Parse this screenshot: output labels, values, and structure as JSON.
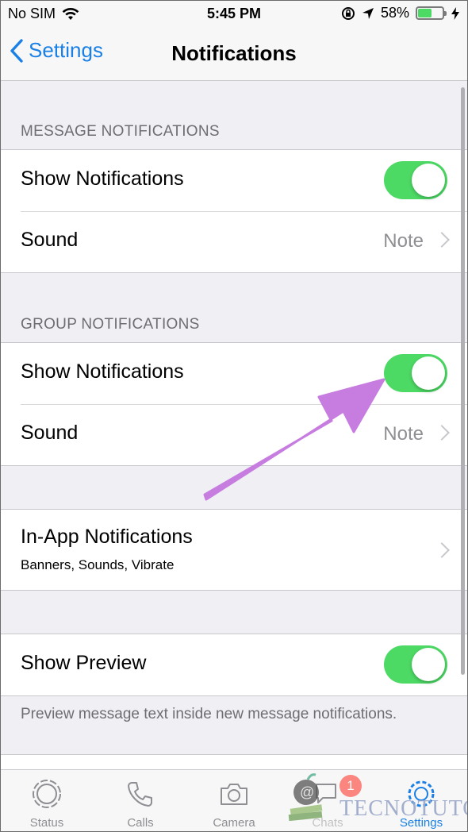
{
  "status_bar": {
    "carrier": "No SIM",
    "time": "5:45 PM",
    "battery_percent": "58%",
    "battery_level": 0.58,
    "icons": [
      "wifi-icon",
      "orientation-lock-icon",
      "location-icon",
      "battery-icon",
      "charging-icon"
    ]
  },
  "nav": {
    "back_label": "Settings",
    "title": "Notifications"
  },
  "message_notifications": {
    "header": "MESSAGE NOTIFICATIONS",
    "show_label": "Show Notifications",
    "show_enabled": true,
    "sound_label": "Sound",
    "sound_value": "Note"
  },
  "group_notifications": {
    "header": "GROUP NOTIFICATIONS",
    "show_label": "Show Notifications",
    "show_enabled": true,
    "sound_label": "Sound",
    "sound_value": "Note"
  },
  "in_app": {
    "label": "In-App Notifications",
    "subtitle": "Banners, Sounds, Vibrate"
  },
  "preview": {
    "label": "Show Preview",
    "enabled": true,
    "footer": "Preview message text inside new message notifications."
  },
  "tabs": [
    {
      "label": "Status",
      "icon": "status-icon",
      "active": false
    },
    {
      "label": "Calls",
      "icon": "phone-icon",
      "active": false
    },
    {
      "label": "Camera",
      "icon": "camera-icon",
      "active": false
    },
    {
      "label": "Chats",
      "icon": "chats-icon",
      "active": false,
      "badge": "1"
    },
    {
      "label": "Settings",
      "icon": "gear-icon",
      "active": true
    }
  ],
  "watermark": "TECNOTUTO",
  "colors": {
    "accent": "#1a80e6",
    "toggle_on": "#4cd964",
    "annotation_arrow": "#c77de0",
    "badge": "#ff3b30"
  }
}
